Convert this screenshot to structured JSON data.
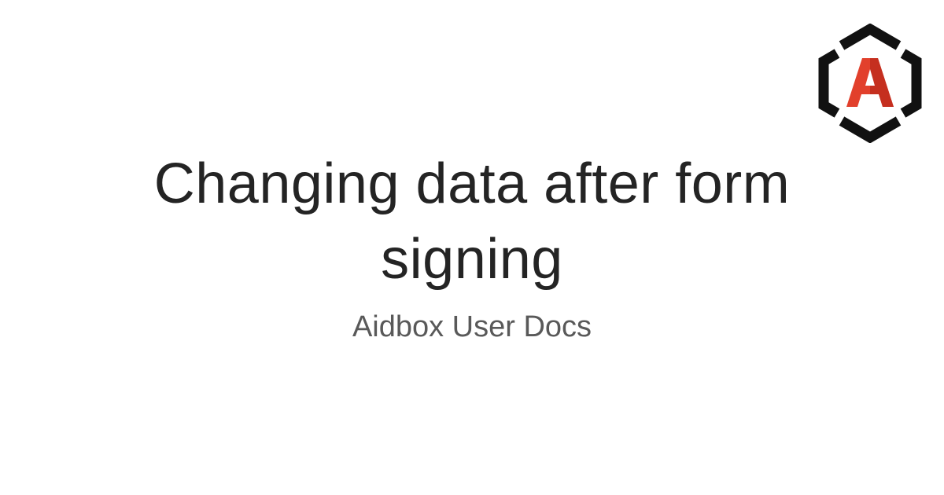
{
  "page": {
    "title": "Changing data after form signing",
    "subtitle": "Aidbox User Docs"
  },
  "logo": {
    "letter": "A",
    "icon": "aidbox-hexagon-logo-icon",
    "colors": {
      "frame": "#111111",
      "letter": "#e2402c",
      "letter_shade": "#b9261a"
    }
  },
  "colors": {
    "background": "#ffffff",
    "title": "#242424",
    "subtitle": "#595959"
  }
}
